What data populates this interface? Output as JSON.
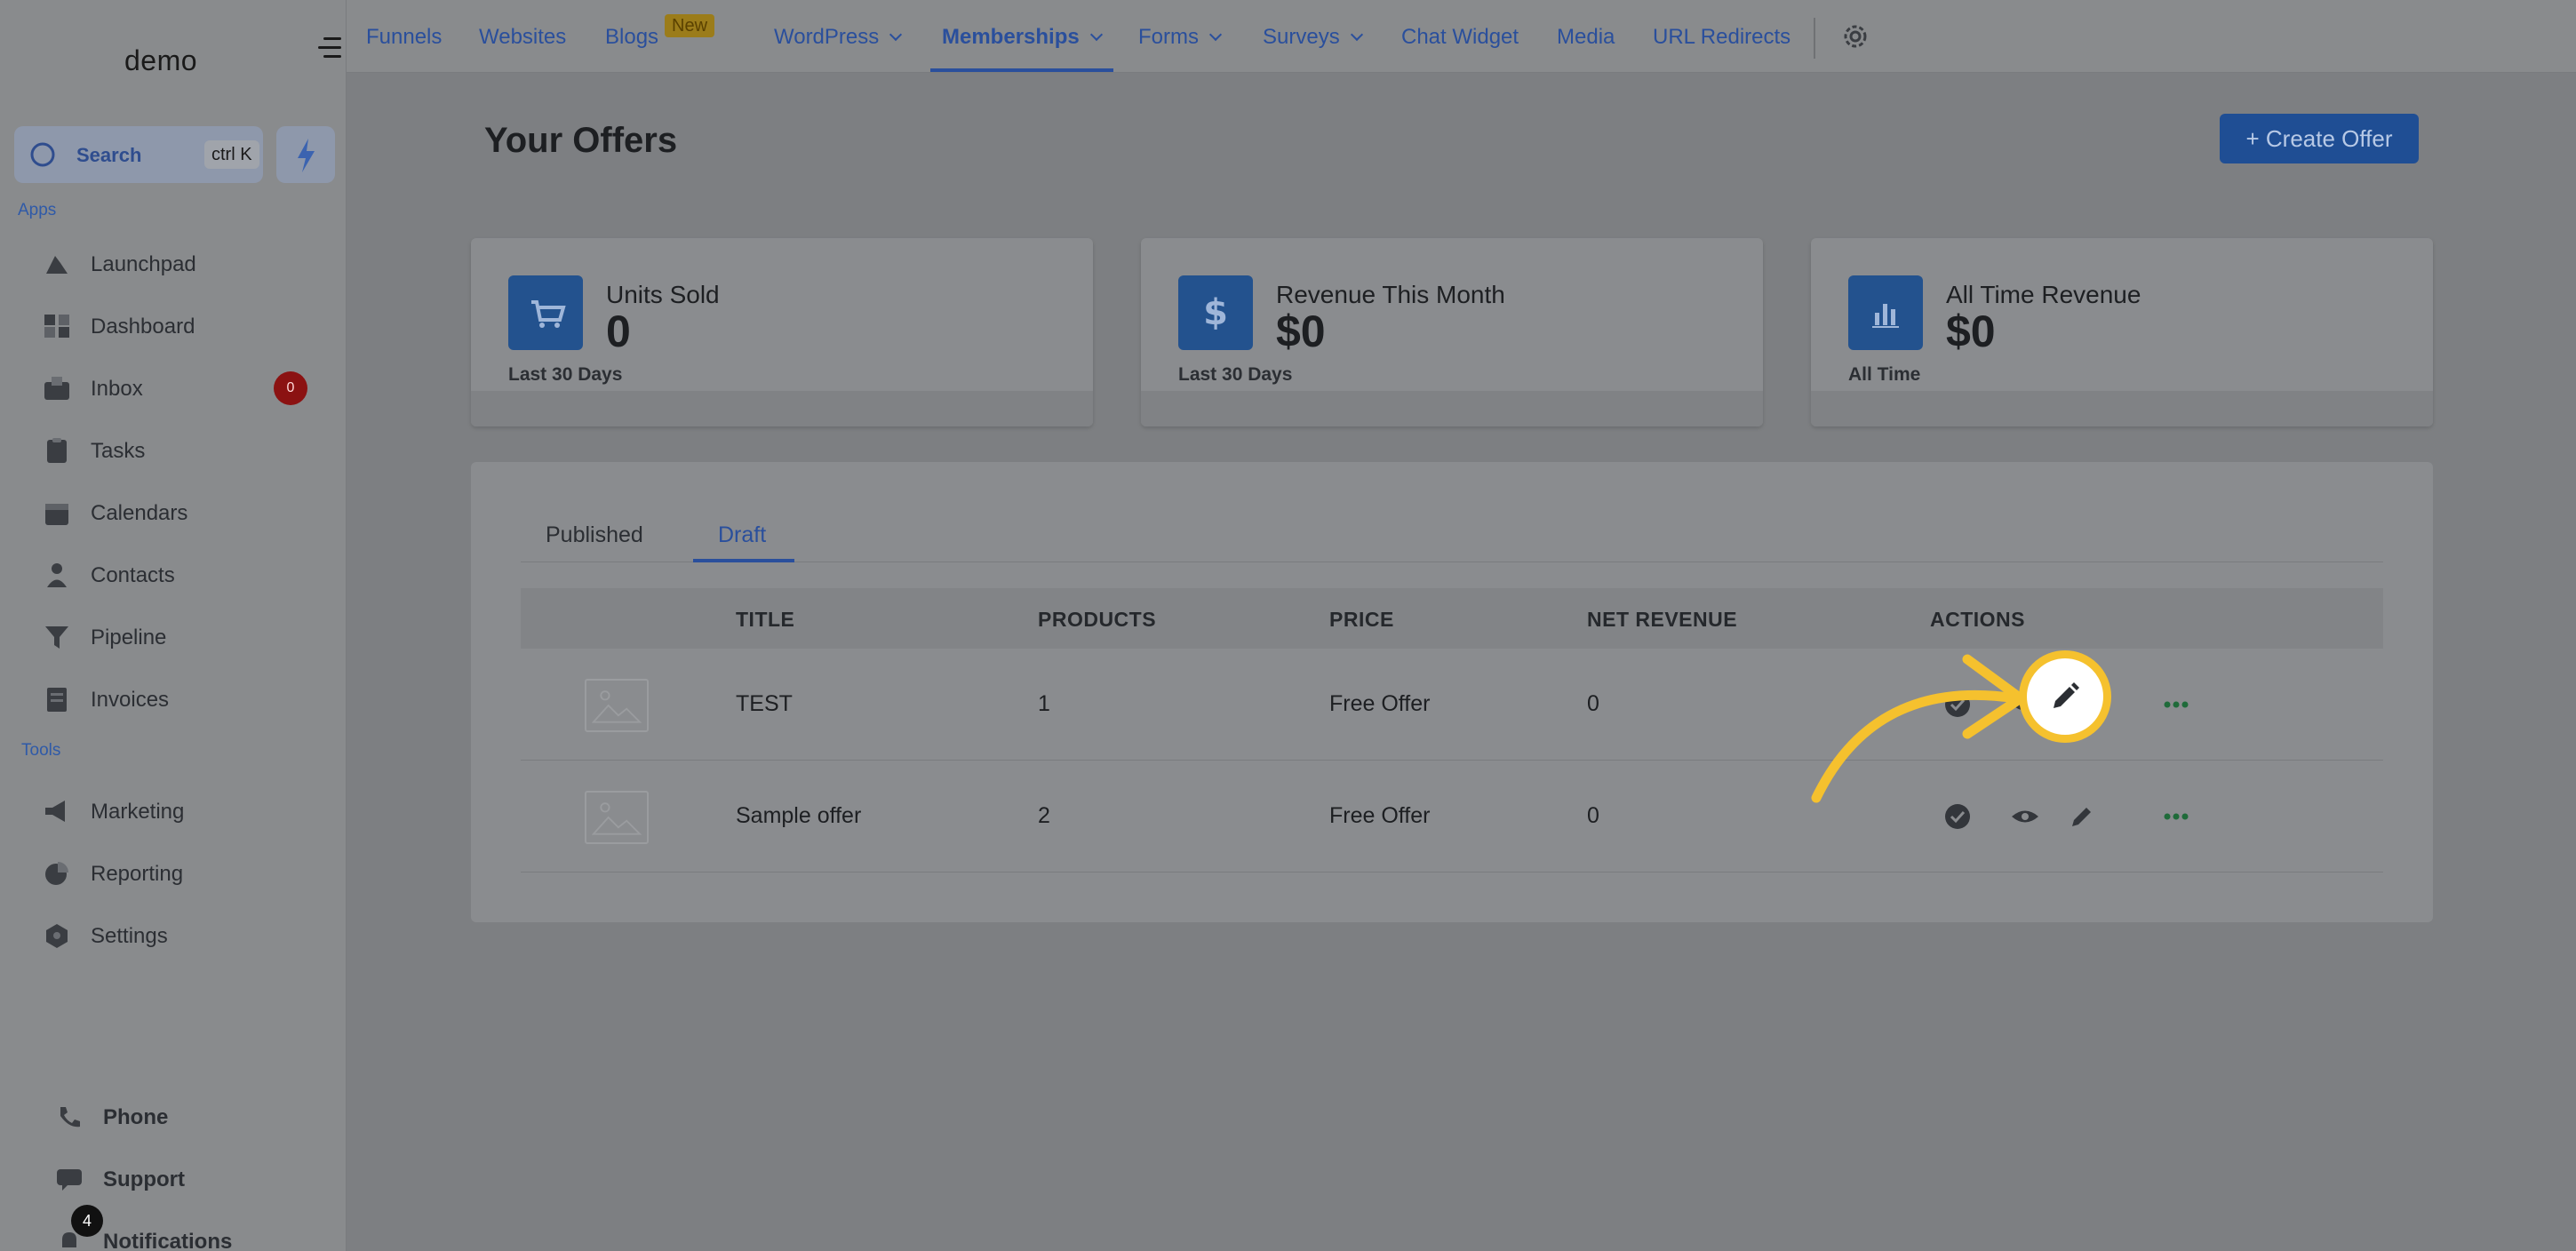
{
  "app": {
    "logo": "demo"
  },
  "search": {
    "label": "Search",
    "shortcut": "ctrl K"
  },
  "sidebar": {
    "apps_label": "Apps",
    "tools_label": "Tools",
    "items": [
      {
        "label": "Launchpad"
      },
      {
        "label": "Dashboard"
      },
      {
        "label": "Inbox",
        "badge": "0"
      },
      {
        "label": "Tasks"
      },
      {
        "label": "Calendars"
      },
      {
        "label": "Contacts"
      },
      {
        "label": "Pipeline"
      },
      {
        "label": "Invoices"
      }
    ],
    "tools": [
      {
        "label": "Marketing"
      },
      {
        "label": "Reporting"
      },
      {
        "label": "Settings"
      }
    ],
    "bottom": [
      {
        "label": "Phone"
      },
      {
        "label": "Support"
      },
      {
        "label": "Notifications",
        "badge": "4"
      }
    ]
  },
  "topnav": {
    "items": [
      {
        "label": "Funnels"
      },
      {
        "label": "Websites"
      },
      {
        "label": "Blogs",
        "badge": "New"
      },
      {
        "label": "WordPress"
      },
      {
        "label": "Memberships"
      },
      {
        "label": "Forms"
      },
      {
        "label": "Surveys"
      },
      {
        "label": "Chat Widget"
      },
      {
        "label": "Media"
      },
      {
        "label": "URL Redirects"
      }
    ]
  },
  "page": {
    "title": "Your Offers",
    "create_button": "+ Create Offer"
  },
  "stats": [
    {
      "label": "Units Sold",
      "value": "0",
      "sub": "Last 30 Days",
      "icon": "cart-icon"
    },
    {
      "label": "Revenue This Month",
      "value": "$0",
      "sub": "Last 30 Days",
      "icon": "dollar-icon"
    },
    {
      "label": "All Time Revenue",
      "value": "$0",
      "sub": "All Time",
      "icon": "bar-chart-icon"
    }
  ],
  "tabs": {
    "published": "Published",
    "draft": "Draft"
  },
  "table": {
    "headers": {
      "title": "TITLE",
      "products": "PRODUCTS",
      "price": "PRICE",
      "net_revenue": "NET REVENUE",
      "actions": "ACTIONS"
    },
    "rows": [
      {
        "title": "TEST",
        "products": "1",
        "price": "Free Offer",
        "net_revenue": "0"
      },
      {
        "title": "Sample offer",
        "products": "2",
        "price": "Free Offer",
        "net_revenue": "0"
      }
    ]
  },
  "colors": {
    "accent": "#2a4f9c",
    "highlight": "#f5c12e",
    "overlay": "#7d7f82"
  }
}
